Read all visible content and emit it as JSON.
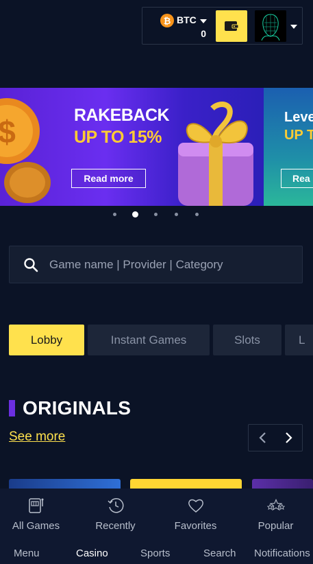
{
  "header": {
    "currency": "BTC",
    "balance": "0"
  },
  "banner": {
    "slides": [
      {
        "title": "RAKEBACK",
        "subtitle": "UP TO 15%",
        "cta": "Read more"
      },
      {
        "title": "Leve",
        "subtitle": "UP T",
        "cta": "Rea"
      }
    ],
    "active_dot": 1,
    "dot_count": 5
  },
  "search": {
    "placeholder": "Game name | Provider | Category"
  },
  "tabs": [
    {
      "label": "Lobby",
      "active": true
    },
    {
      "label": "Instant Games",
      "active": false
    },
    {
      "label": "Slots",
      "active": false
    },
    {
      "label": "L",
      "active": false
    }
  ],
  "originals": {
    "title": "ORIGINALS",
    "see_more": "See more"
  },
  "subnav": [
    {
      "label": "All Games",
      "icon": "slot-machine-icon"
    },
    {
      "label": "Recently",
      "icon": "history-icon"
    },
    {
      "label": "Favorites",
      "icon": "heart-icon"
    },
    {
      "label": "Popular",
      "icon": "stars-icon"
    }
  ],
  "mainnav": [
    {
      "label": "Menu",
      "active": false
    },
    {
      "label": "Casino",
      "active": true
    },
    {
      "label": "Sports",
      "active": false
    },
    {
      "label": "Search",
      "active": false
    },
    {
      "label": "Notifications",
      "active": false
    }
  ],
  "colors": {
    "background": "#0b1326",
    "accent": "#ffe14d",
    "purple": "#6b2fe0",
    "bitcoin": "#f7931a"
  }
}
